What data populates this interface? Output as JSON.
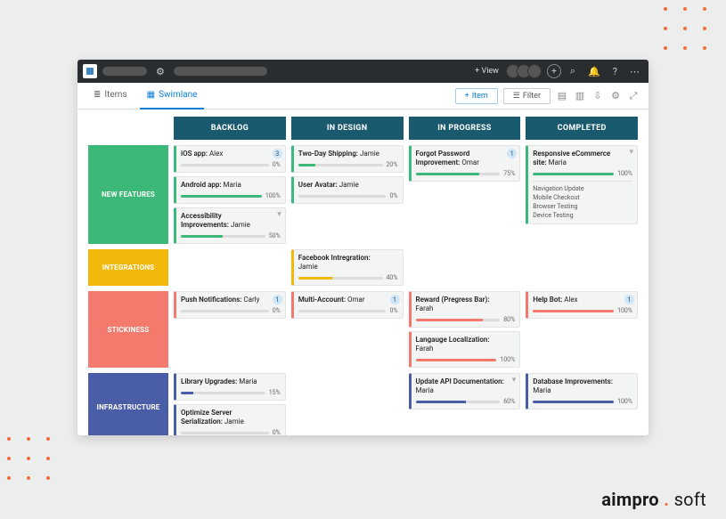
{
  "topbar": {
    "view_label": "+ View",
    "icons": {
      "gear": "⚙",
      "search": "⌕",
      "bell": "🔔",
      "help": "?",
      "more": "⋯",
      "plus": "+"
    }
  },
  "toolbar": {
    "tabs": [
      {
        "label": "Items",
        "icon": "≣"
      },
      {
        "label": "Swimlane",
        "icon": "▦"
      }
    ],
    "item_btn": "Item",
    "filter_btn": "Filter",
    "action_icons": [
      "▤",
      "▥",
      "⇩",
      "⚙",
      "⤢"
    ]
  },
  "columns": [
    "BACKLOG",
    "IN DESIGN",
    "IN PROGRESS",
    "COMPLETED"
  ],
  "lane_colors": {
    "new_features": "#3cb878",
    "integrations": "#f2b90c",
    "stickiness": "#f47a6e",
    "infrastructure": "#4a5ea8"
  },
  "card_colors": {
    "green": "#3cb97a",
    "yellow": "#f2b90c",
    "salmon": "#f4796c",
    "blue": "#4a5ea8"
  },
  "lanes": [
    {
      "name": "NEW FEATURES",
      "key": "new_features",
      "cells": [
        [
          {
            "title": "iOS app:",
            "assignee": "Alex",
            "pct": 0,
            "color": "green",
            "badge": "3"
          },
          {
            "title": "Android app:",
            "assignee": "Maria",
            "pct": 100,
            "color": "green"
          },
          {
            "title": "Accessibility Improvements:",
            "assignee": "Jamie",
            "pct": 50,
            "color": "green",
            "chev": true
          }
        ],
        [
          {
            "title": "Two-Day Shipping:",
            "assignee": "Jamie",
            "pct": 20,
            "color": "green"
          },
          {
            "title": "User Avatar:",
            "assignee": "Jamie",
            "pct": 0,
            "color": "green"
          }
        ],
        [
          {
            "title": "Forgot Password Improvement:",
            "assignee": "Omar",
            "pct": 75,
            "color": "green",
            "badge": "1"
          }
        ],
        [
          {
            "title": "Responsive eCommerce site:",
            "assignee": "Maria",
            "pct": 100,
            "color": "green",
            "chev": true,
            "subtasks": [
              "Navigation Update",
              "Mobile Checkout",
              "Browser Testing",
              "Device Testing"
            ]
          }
        ]
      ]
    },
    {
      "name": "INTEGRATIONS",
      "key": "integrations",
      "cells": [
        [],
        [
          {
            "title": "Facebook Intregration:",
            "assignee": "Jamie",
            "pct": 40,
            "color": "yellow"
          }
        ],
        [],
        []
      ]
    },
    {
      "name": "STICKINESS",
      "key": "stickiness",
      "cells": [
        [
          {
            "title": "Push Notifications:",
            "assignee": "Carly",
            "pct": 0,
            "color": "salmon",
            "badge": "1"
          }
        ],
        [
          {
            "title": "Multi-Account:",
            "assignee": "Omar",
            "pct": 0,
            "color": "salmon",
            "badge": "1"
          }
        ],
        [
          {
            "title": "Reward (Pregress Bar):",
            "assignee": "Farah",
            "pct": 80,
            "color": "salmon"
          },
          {
            "title": "Langauge Localization:",
            "assignee": "Farah",
            "pct": 100,
            "color": "salmon"
          }
        ],
        [
          {
            "title": "Help Bot:",
            "assignee": "Alex",
            "pct": 100,
            "color": "salmon",
            "badge": "1"
          }
        ]
      ]
    },
    {
      "name": "INFRASTRUCTURE",
      "key": "infrastructure",
      "cells": [
        [
          {
            "title": "Library Upgrades:",
            "assignee": "Maria",
            "pct": 15,
            "color": "blue"
          },
          {
            "title": "Optimize Server Serialization:",
            "assignee": "Jamie",
            "pct": 0,
            "color": "blue"
          }
        ],
        [],
        [
          {
            "title": "Update API Documentation:",
            "assignee": "Maria",
            "pct": 60,
            "color": "blue",
            "chev": true
          }
        ],
        [
          {
            "title": "Database Improvements:",
            "assignee": "Maria",
            "pct": 100,
            "color": "blue"
          }
        ]
      ]
    }
  ],
  "watermark": {
    "p1": "aimpro",
    "p2": "soft"
  }
}
